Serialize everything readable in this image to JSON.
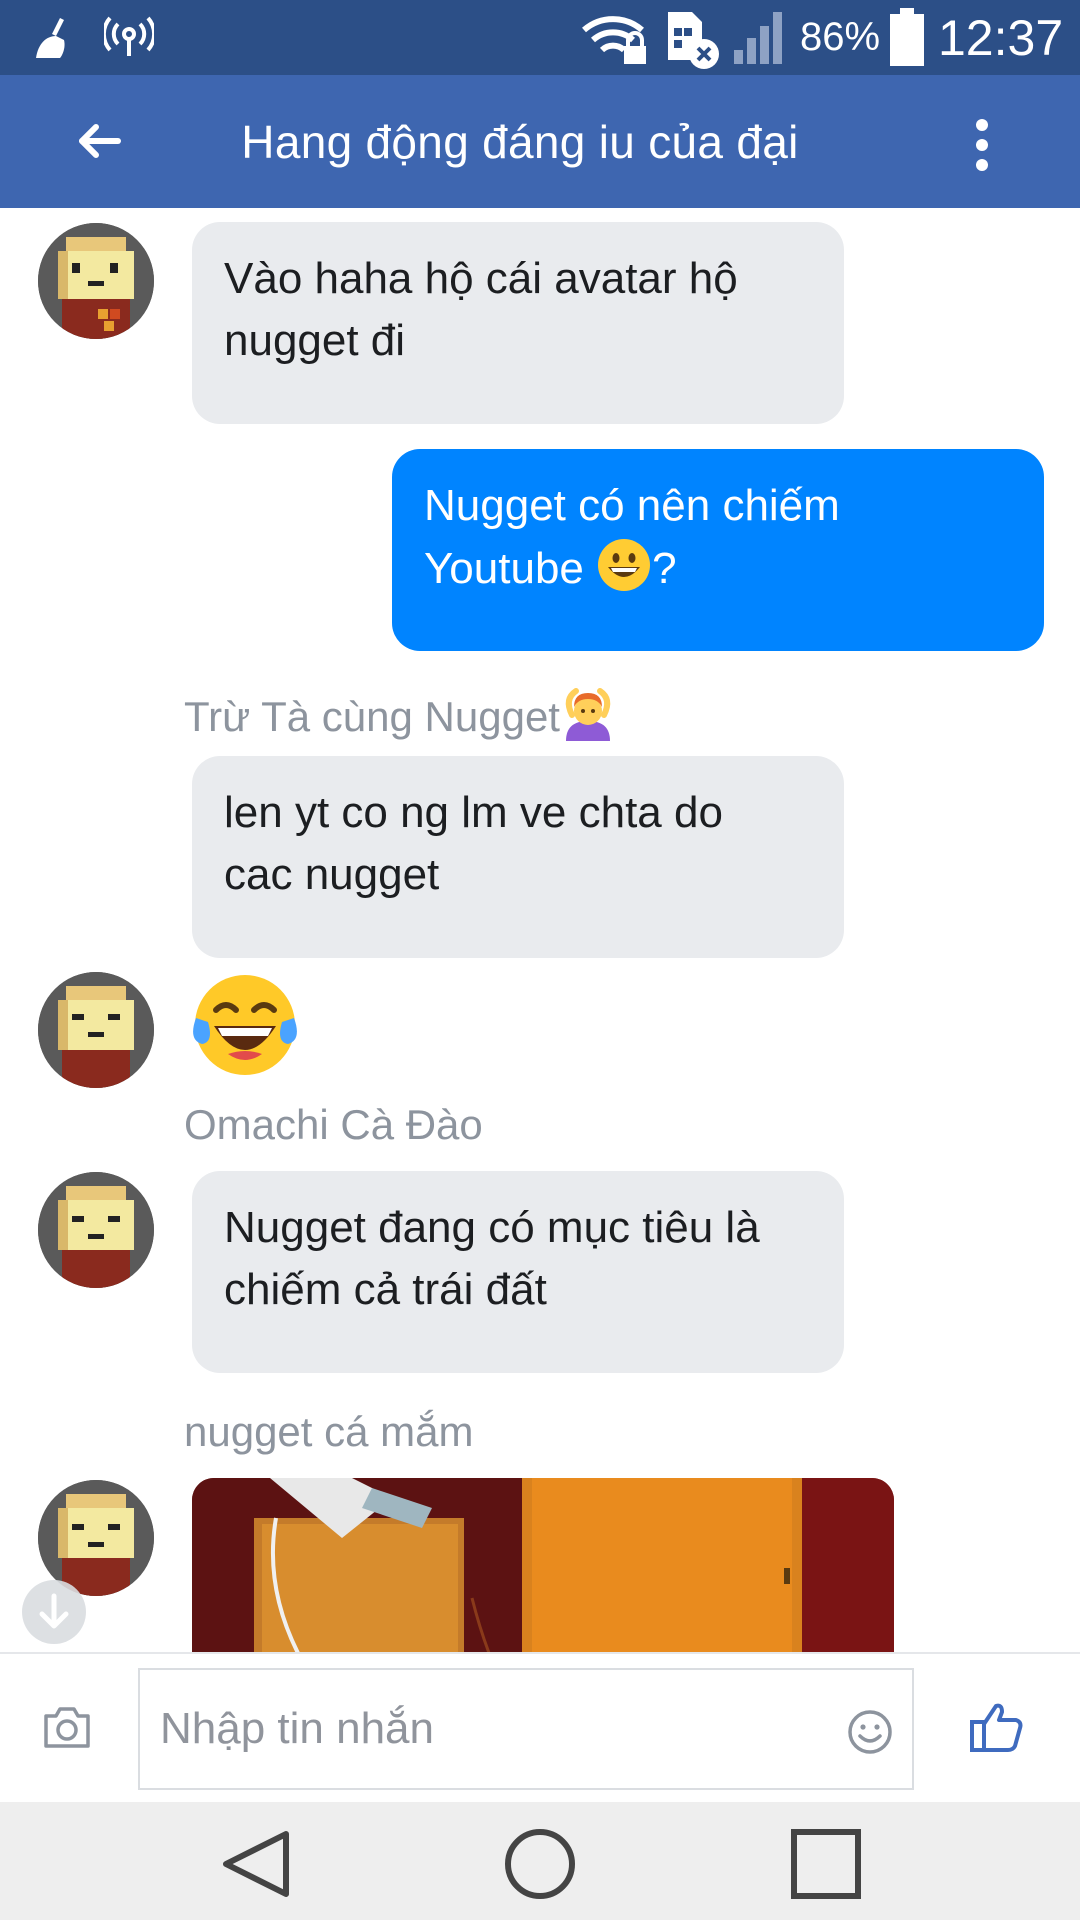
{
  "status_bar": {
    "battery_percent": "86%",
    "time": "12:37",
    "icons": [
      "cleaner-icon",
      "hotspot-icon",
      "wifi-lock-icon",
      "sim-error-icon",
      "signal-icon",
      "battery-icon"
    ]
  },
  "header": {
    "title": "Hang động đáng iu của đại",
    "back_icon": "back-arrow-icon",
    "menu_icon": "more-vert-icon"
  },
  "messages": [
    {
      "type": "incoming",
      "lines": [
        "Vào haha hộ cái avatar hộ",
        "nugget đi"
      ]
    },
    {
      "type": "outgoing",
      "lines": [
        "Nugget có nên chiếm",
        "Youtube"
      ],
      "suffix": "?",
      "emoji": "grinning-face"
    },
    {
      "type": "sender",
      "name": "Trừ Tà cùng Nugget",
      "emoji": "person-heart-hands"
    },
    {
      "type": "incoming",
      "lines": [
        "len yt co ng lm ve chta do",
        "cac nugget"
      ]
    },
    {
      "type": "emoji",
      "emoji": "tears-of-joy"
    },
    {
      "type": "sender",
      "name": "Omachi Cà Đào"
    },
    {
      "type": "incoming",
      "lines": [
        "Nugget đang có mục tiêu là",
        "chiếm cả trái đất"
      ]
    },
    {
      "type": "sender",
      "name": "nugget cá mắm"
    },
    {
      "type": "photo"
    }
  ],
  "composer": {
    "placeholder": "Nhập tin nhắn",
    "camera_icon": "camera-icon",
    "emoji_icon": "smiley-icon",
    "like_icon": "thumbs-up-icon"
  },
  "nav": {
    "icons": [
      "nav-back-icon",
      "nav-home-icon",
      "nav-recents-icon"
    ]
  },
  "colors": {
    "status_bar": "#2c4f87",
    "header": "#3e66b0",
    "outgoing_bubble": "#0084ff",
    "incoming_bubble": "#e9ebee",
    "like_blue": "#3f6bbf"
  }
}
